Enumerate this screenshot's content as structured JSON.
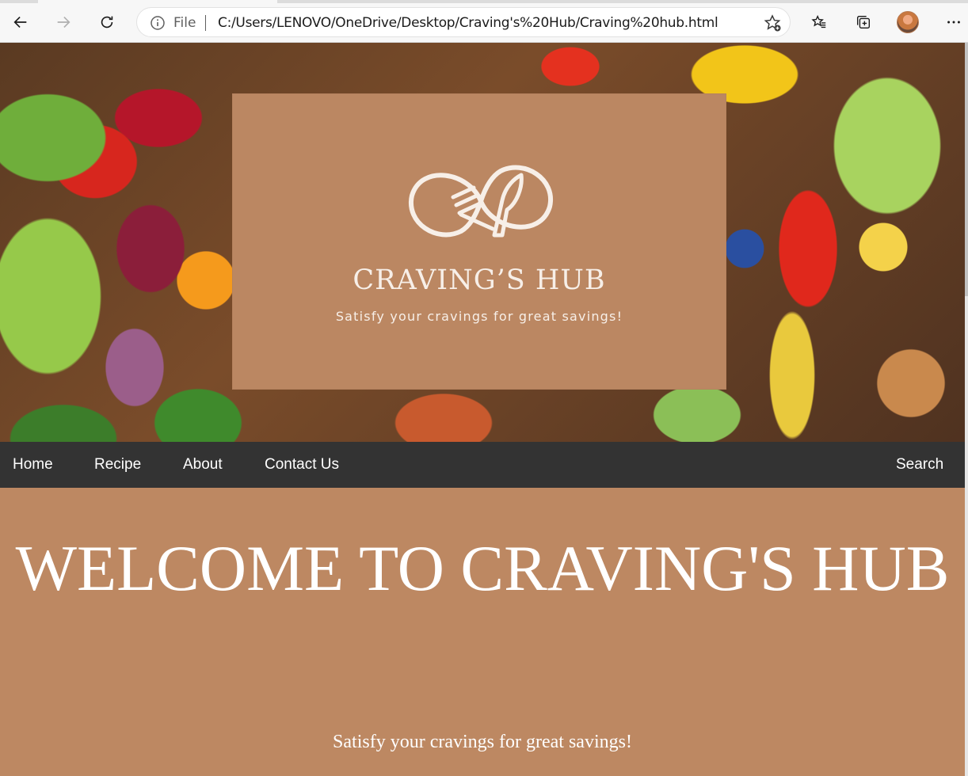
{
  "browser": {
    "address_prefix": "File",
    "url": "C:/Users/LENOVO/OneDrive/Desktop/Craving's%20Hub/Craving%20hub.html",
    "icons": [
      "back-icon",
      "forward-icon",
      "refresh-icon",
      "info-icon",
      "add-favorite-icon",
      "favorites-icon",
      "collections-icon",
      "profile-avatar",
      "more-icon"
    ]
  },
  "hero": {
    "logo_name": "CRAVING’S HUB",
    "logo_tagline": "Satisfy your cravings for great savings!"
  },
  "nav": {
    "home": "Home",
    "recipe": "Recipe",
    "about": "About",
    "contact": "Contact Us",
    "search": "Search"
  },
  "main": {
    "heading": "WELCOME TO CRAVING'S HUB",
    "subtitle": "Satisfy your cravings for great savings!"
  },
  "colors": {
    "navbar": "#333333",
    "brand_brown": "#bd8862",
    "text_light": "#ffffff"
  }
}
